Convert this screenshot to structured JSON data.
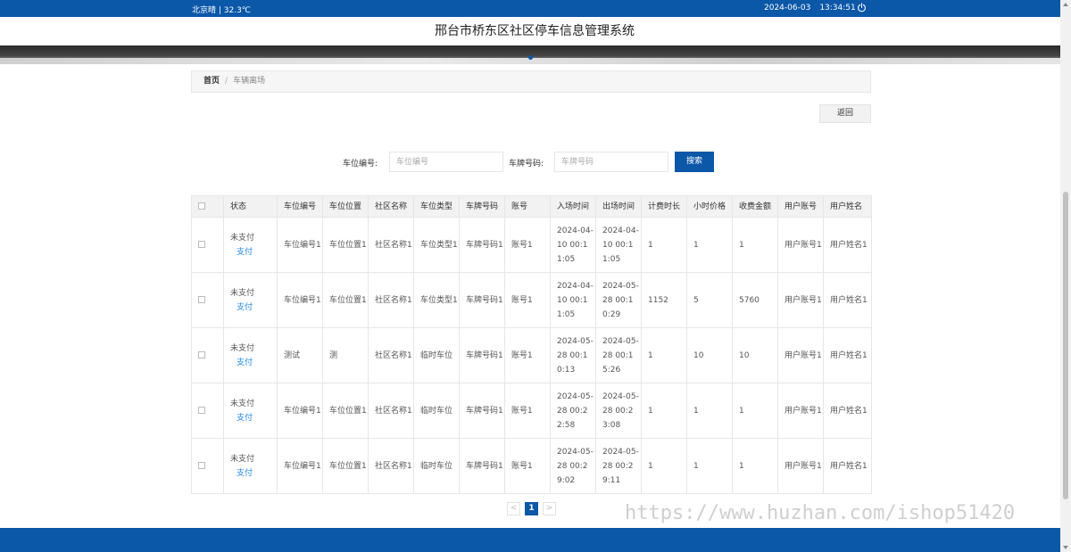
{
  "topbar": {
    "weather": "北京晴 | 32.3℃",
    "date": "2024-06-03",
    "time": "13:34:51"
  },
  "header": {
    "title": "邢台市桥东区社区停车信息管理系统"
  },
  "breadcrumb": {
    "home": "首页",
    "separator": "/",
    "current": "车辆离场"
  },
  "actions": {
    "back_label": "返回"
  },
  "search": {
    "slot_label": "车位编号:",
    "slot_placeholder": "车位编号",
    "plate_label": "车牌号码:",
    "plate_placeholder": "车牌号码",
    "button_label": "搜索"
  },
  "table": {
    "columns": [
      "状态",
      "车位编号",
      "车位位置",
      "社区名称",
      "车位类型",
      "车牌号码",
      "账号",
      "入场时间",
      "出场时间",
      "计费时长",
      "小时价格",
      "收费金额",
      "用户账号",
      "用户姓名"
    ],
    "pay_label": "支付",
    "rows": [
      {
        "status": "未支付",
        "slot_no": "车位编号1",
        "slot_pos": "车位位置1",
        "community": "社区名称1",
        "slot_type": "车位类型1",
        "plate": "车牌号码1",
        "account": "账号1",
        "in_time": "2024-04-10 00:11:05",
        "out_time": "2024-04-10 00:11:05",
        "duration": "1",
        "hour_price": "1",
        "amount": "1",
        "user_account": "用户账号1",
        "user_name": "用户姓名1"
      },
      {
        "status": "未支付",
        "slot_no": "车位编号1",
        "slot_pos": "车位位置1",
        "community": "社区名称1",
        "slot_type": "车位类型1",
        "plate": "车牌号码1",
        "account": "账号1",
        "in_time": "2024-04-10 00:11:05",
        "out_time": "2024-05-28 00:10:29",
        "duration": "1152",
        "hour_price": "5",
        "amount": "5760",
        "user_account": "用户账号1",
        "user_name": "用户姓名1"
      },
      {
        "status": "未支付",
        "slot_no": "测试",
        "slot_pos": "测",
        "community": "社区名称1",
        "slot_type": "临时车位",
        "plate": "车牌号码1",
        "account": "账号1",
        "in_time": "2024-05-28 00:10:13",
        "out_time": "2024-05-28 00:15:26",
        "duration": "1",
        "hour_price": "10",
        "amount": "10",
        "user_account": "用户账号1",
        "user_name": "用户姓名1"
      },
      {
        "status": "未支付",
        "slot_no": "车位编号1",
        "slot_pos": "车位位置1",
        "community": "社区名称1",
        "slot_type": "临时车位",
        "plate": "车牌号码1",
        "account": "账号1",
        "in_time": "2024-05-28 00:22:58",
        "out_time": "2024-05-28 00:23:08",
        "duration": "1",
        "hour_price": "1",
        "amount": "1",
        "user_account": "用户账号1",
        "user_name": "用户姓名1"
      },
      {
        "status": "未支付",
        "slot_no": "车位编号1",
        "slot_pos": "车位位置1",
        "community": "社区名称1",
        "slot_type": "临时车位",
        "plate": "车牌号码1",
        "account": "账号1",
        "in_time": "2024-05-28 00:29:02",
        "out_time": "2024-05-28 00:29:11",
        "duration": "1",
        "hour_price": "1",
        "amount": "1",
        "user_account": "用户账号1",
        "user_name": "用户姓名1"
      }
    ]
  },
  "pagination": {
    "prev": "<",
    "current": "1",
    "next": ">"
  },
  "watermark": "https://www.huzhan.com/ishop51420",
  "colors": {
    "primary": "#0b57a8",
    "link": "#1e88e5"
  },
  "icons": {
    "power": "power-icon"
  }
}
